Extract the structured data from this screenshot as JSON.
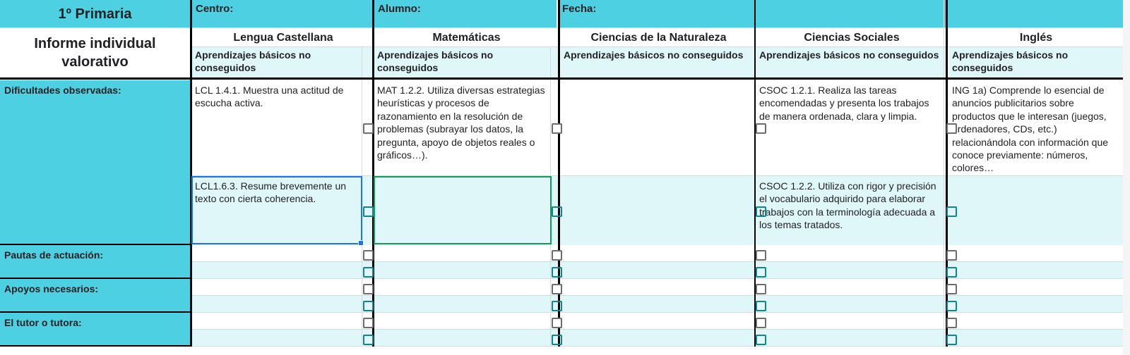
{
  "header": {
    "grade": "1º Primaria",
    "report_title": "Informe individual valorativo",
    "centro_label": "Centro:",
    "alumno_label": "Alumno:",
    "fecha_label": "Fecha:"
  },
  "subjects": [
    {
      "name": "Lengua Castellana",
      "col_header": "Aprendizajes básicos no conseguidos"
    },
    {
      "name": "Matemáticas",
      "col_header": "Aprendizajes básicos no conseguidos"
    },
    {
      "name": "Ciencias de la Naturaleza",
      "col_header": "Aprendizajes básicos no conseguidos"
    },
    {
      "name": "Ciencias Sociales",
      "col_header": "Aprendizajes básicos no conseguidos"
    },
    {
      "name": "Inglés",
      "col_header": "Aprendizajes básicos no conseguidos"
    }
  ],
  "row_labels": {
    "dificultades": "Dificultades observadas:",
    "pautas": "Pautas de actuación:",
    "apoyos": "Apoyos necesarios:",
    "tutor": "El tutor o tutora:"
  },
  "items": {
    "lcl_1": "LCL 1.4.1. Muestra una actitud de escucha activa.",
    "lcl_2": "LCL1.6.3. Resume brevemente un texto con cierta coherencia.",
    "mat_1": "MAT 1.2.2. Utiliza diversas estrategias heurísticas y procesos de razonamiento en la resolución de problemas (subrayar los datos, la pregunta, apoyo de objetos reales o gráficos…).",
    "csoc_1": "CSOC 1.2.1. Realiza las tareas encomendadas y presenta los trabajos de manera ordenada, clara y limpia.",
    "csoc_2": "CSOC 1.2.2. Utiliza con rigor y precisión el vocabulario adquirido para elaborar trabajos con la terminología adecuada a los temas tratados.",
    "ing_1": "ING 1a) Comprende lo esencial de anuncios publicitarios sobre productos que le interesan (juegos, ordenadores, CDs, etc.) relacionándola con información que conoce previamente: números, colores…"
  },
  "colors": {
    "header_cyan": "#4dd0e1",
    "light_cyan": "#e0f7fa",
    "selection_blue": "#1a73e8",
    "selection_green": "#0f9d58",
    "checkbox_teal": "#14838f",
    "checkbox_gray": "#6d6d6d"
  }
}
